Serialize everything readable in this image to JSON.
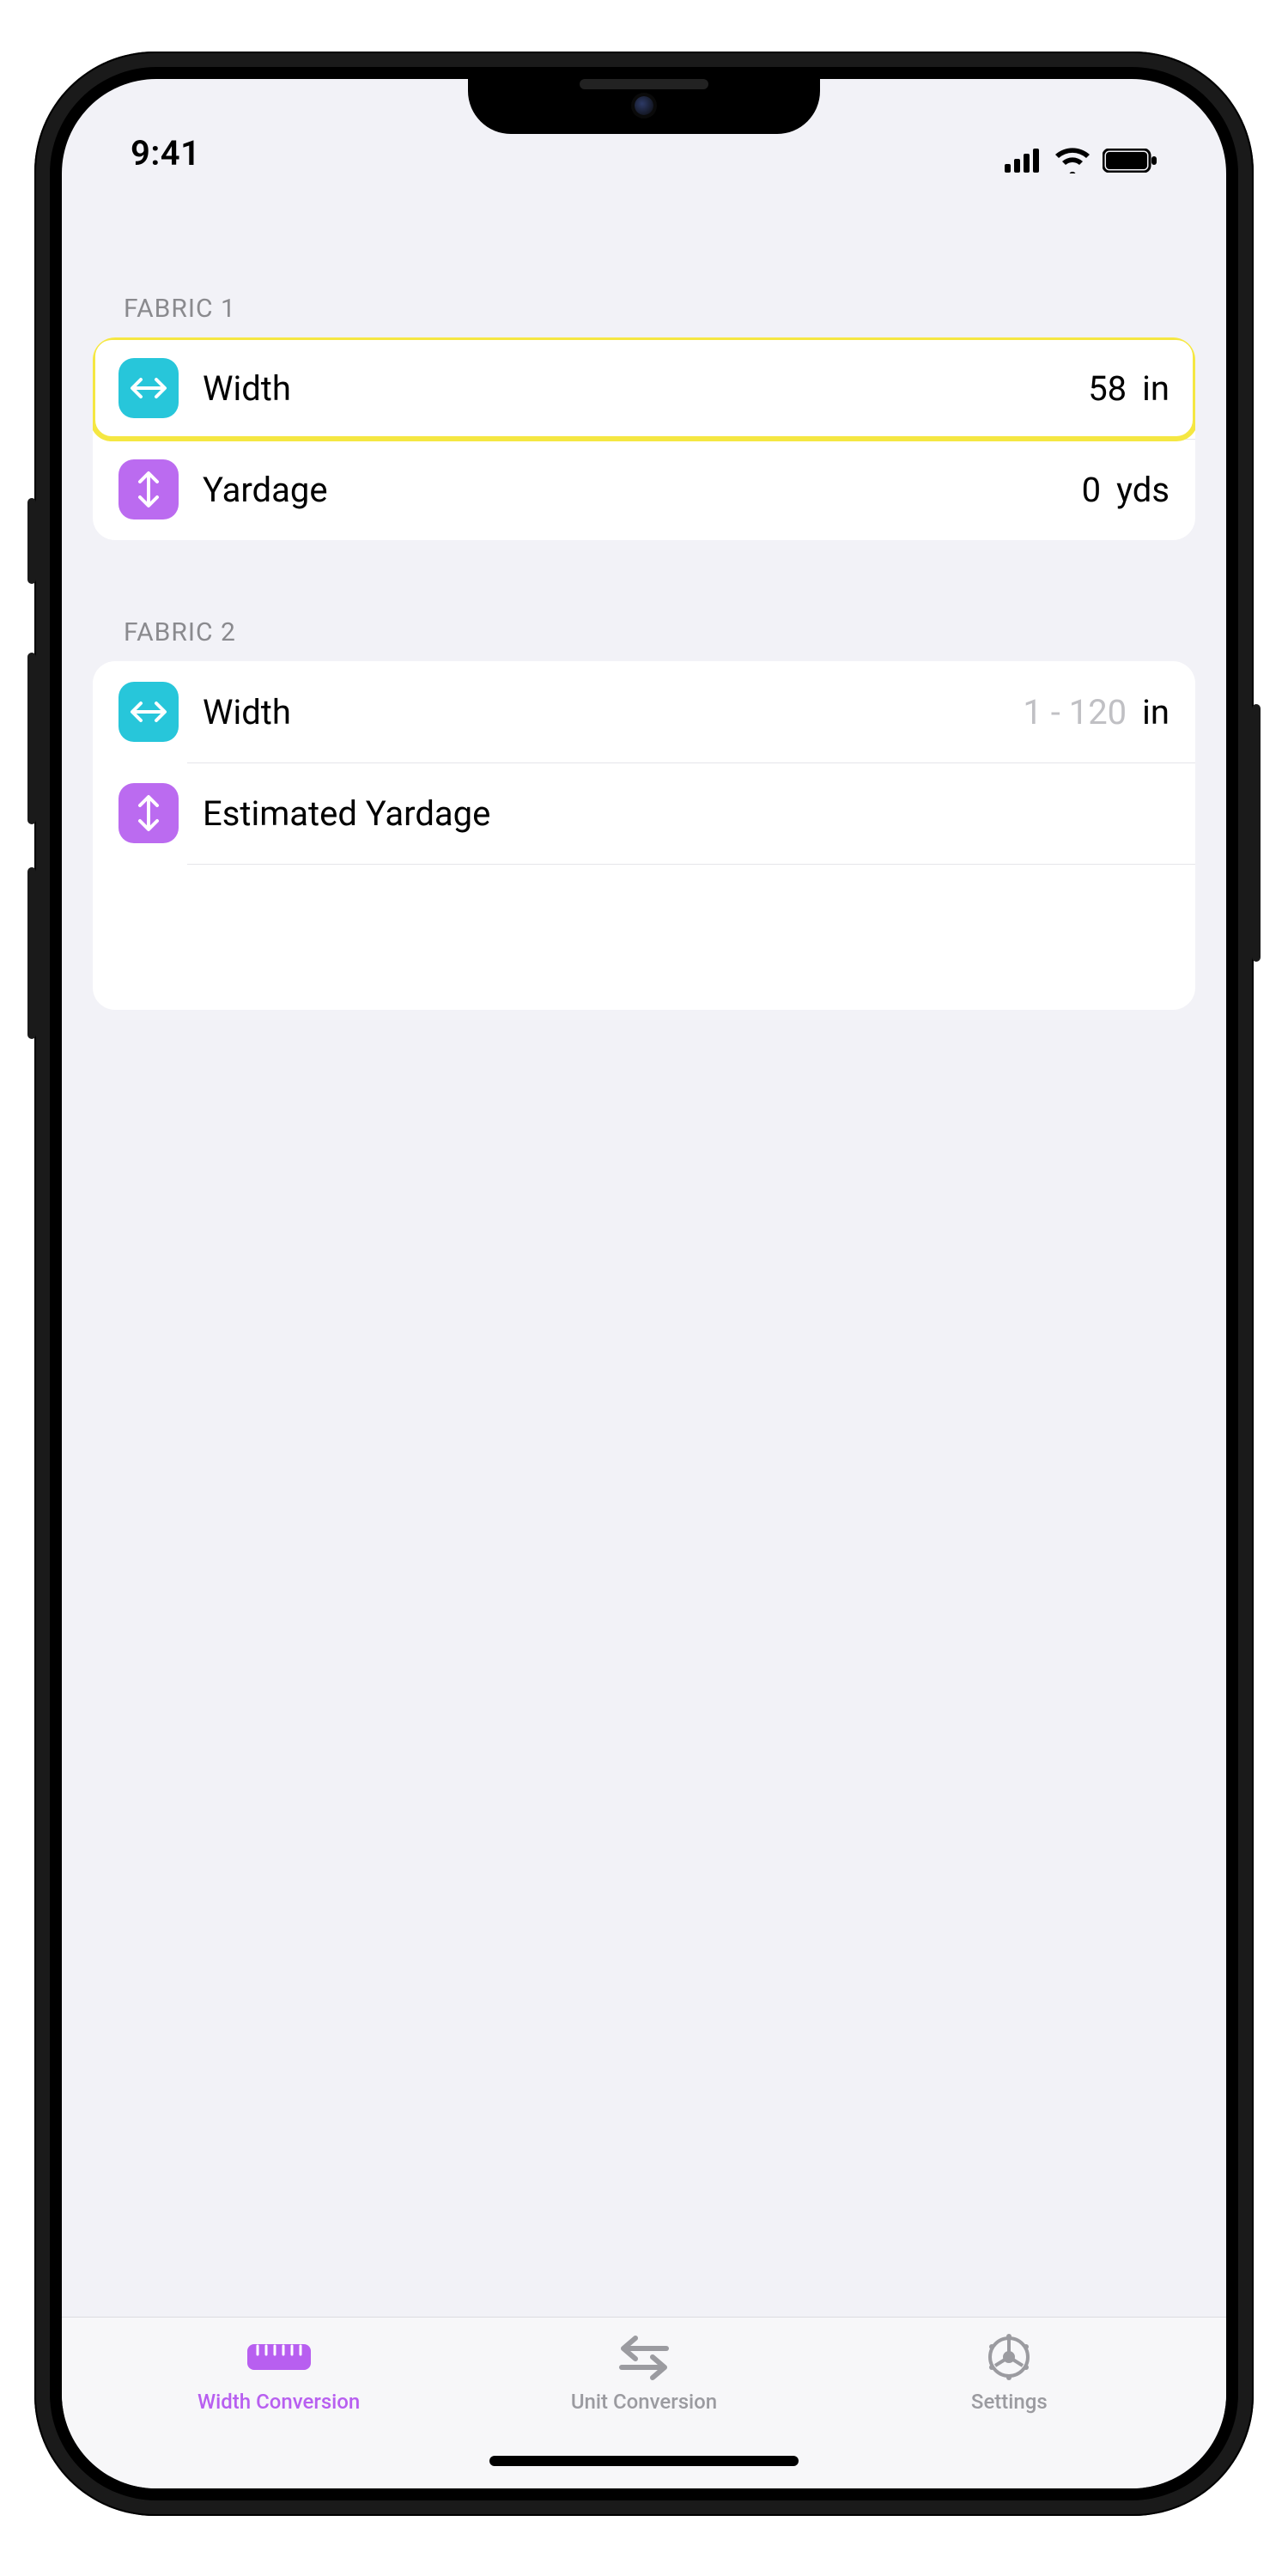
{
  "statusbar": {
    "time": "9:41"
  },
  "colors": {
    "accent_purple": "#b85ff0",
    "icon_cyan": "#27c6da",
    "icon_purple": "#bb6bf0",
    "highlight": "#f5e742"
  },
  "sections": {
    "fabric1": {
      "header": "FABRIC 1",
      "width": {
        "label": "Width",
        "value": "58",
        "unit": "in"
      },
      "yardage": {
        "label": "Yardage",
        "value": "0",
        "unit": "yds"
      }
    },
    "fabric2": {
      "header": "FABRIC 2",
      "width": {
        "label": "Width",
        "placeholder": "1 - 120",
        "unit": "in"
      },
      "estimated": {
        "label": "Estimated Yardage"
      }
    }
  },
  "tabs": {
    "width_conversion": "Width Conversion",
    "unit_conversion": "Unit Conversion",
    "settings": "Settings"
  }
}
